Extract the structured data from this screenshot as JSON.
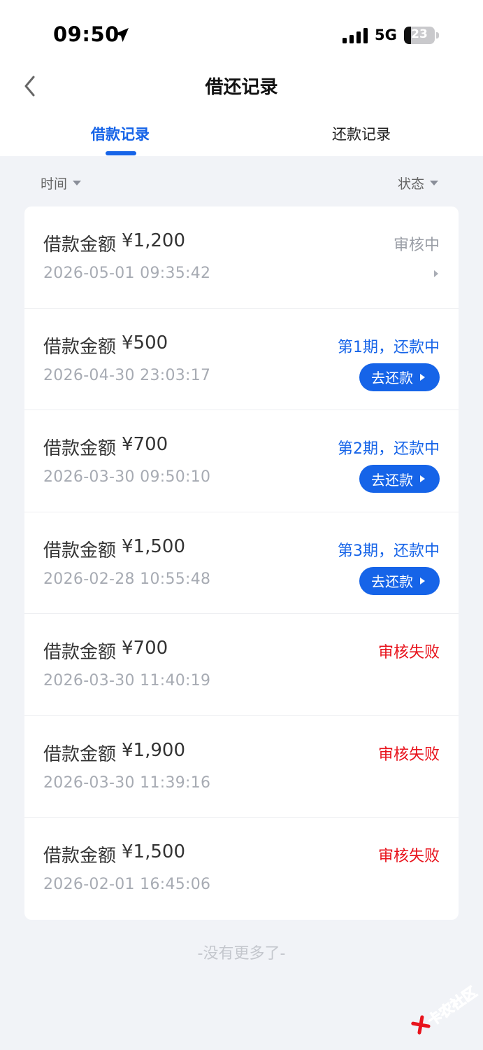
{
  "status_bar": {
    "time": "09:50",
    "network": "5G",
    "battery": "23",
    "battery_level": 0.23
  },
  "nav": {
    "title": "借还记录"
  },
  "tabs": [
    {
      "label": "借款记录",
      "active": true
    },
    {
      "label": "还款记录",
      "active": false
    }
  ],
  "filters": {
    "time": "时间",
    "status": "状态"
  },
  "records": [
    {
      "label": "借款金额",
      "amount": "¥1,200",
      "time": "2026-05-01 09:35:42",
      "status": "审核中",
      "status_color": "gray",
      "button": ""
    },
    {
      "label": "借款金额",
      "amount": "¥500",
      "time": "2026-04-30 23:03:17",
      "status": "第1期，还款中",
      "status_color": "blue",
      "button": "去还款"
    },
    {
      "label": "借款金额",
      "amount": "¥700",
      "time": "2026-03-30 09:50:10",
      "status": "第2期，还款中",
      "status_color": "blue",
      "button": "去还款"
    },
    {
      "label": "借款金额",
      "amount": "¥1,500",
      "time": "2026-02-28 10:55:48",
      "status": "第3期，还款中",
      "status_color": "blue",
      "button": "去还款"
    },
    {
      "label": "借款金额",
      "amount": "¥700",
      "time": "2026-03-30 11:40:19",
      "status": "审核失败",
      "status_color": "red",
      "button": ""
    },
    {
      "label": "借款金额",
      "amount": "¥1,900",
      "time": "2026-03-30 11:39:16",
      "status": "审核失败",
      "status_color": "red",
      "button": ""
    },
    {
      "label": "借款金额",
      "amount": "¥1,500",
      "time": "2026-02-01 16:45:06",
      "status": "审核失败",
      "status_color": "red",
      "button": ""
    }
  ],
  "footer": {
    "no_more": "-没有更多了-"
  },
  "watermark": {
    "text": "卡农社区"
  },
  "colors": {
    "accent": "#1664e8",
    "fail": "#e8131c",
    "pending": "#9a9ea6"
  }
}
